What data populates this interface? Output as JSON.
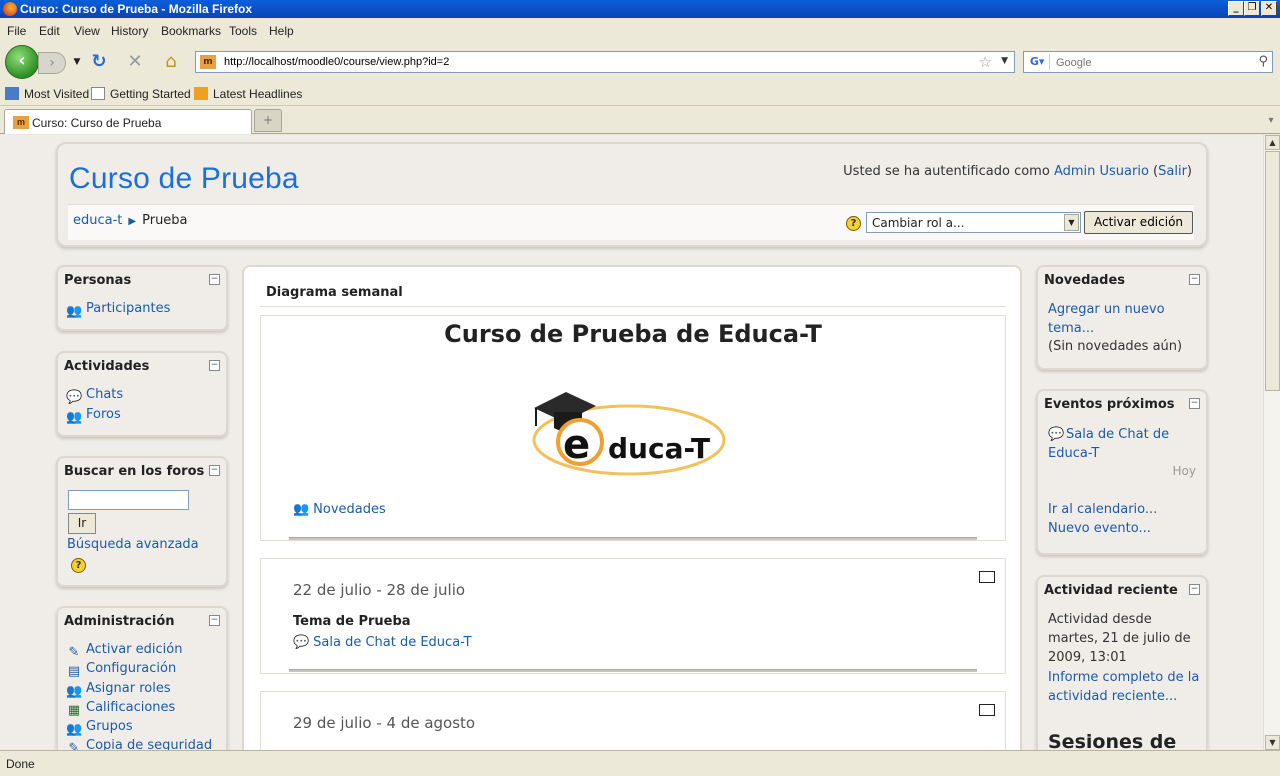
{
  "window": {
    "title": "Curso: Curso de Prueba - Mozilla Firefox"
  },
  "menu": [
    "File",
    "Edit",
    "View",
    "History",
    "Bookmarks",
    "Tools",
    "Help"
  ],
  "nav": {
    "url": "http://localhost/moodle0/course/view.php?id=2",
    "search_placeholder": "Google"
  },
  "bookmarks": [
    "Most Visited",
    "Getting Started",
    "Latest Headlines"
  ],
  "tab": {
    "label": "Curso: Curso de Prueba"
  },
  "status": "Done",
  "header": {
    "course_title": "Curso de Prueba",
    "login_prefix": "Usted se ha autentificado como",
    "user_name": "Admin Usuario",
    "logout": "Salir",
    "breadcrumb": [
      "educa-t",
      "Prueba"
    ],
    "role_select": "Cambiar rol a...",
    "edit_button": "Activar edición"
  },
  "left": {
    "personas": {
      "title": "Personas",
      "items": [
        "Participantes"
      ]
    },
    "actividades": {
      "title": "Actividades",
      "items": [
        "Chats",
        "Foros"
      ]
    },
    "buscar": {
      "title": "Buscar en los foros",
      "go": "Ir",
      "advanced": "Búsqueda avanzada"
    },
    "admin": {
      "title": "Administración",
      "items": [
        "Activar edición",
        "Configuración",
        "Asignar roles",
        "Calificaciones",
        "Grupos",
        "Copia de seguridad"
      ]
    }
  },
  "center": {
    "header": "Diagrama semanal",
    "section0": {
      "title": "Curso de Prueba de Educa-T",
      "logo_text": "educa-T",
      "forum": "Novedades"
    },
    "week1": {
      "dates": "22 de julio - 28 de julio",
      "topic": "Tema de Prueba",
      "chat": "Sala de Chat de Educa-T"
    },
    "week2": {
      "dates": "29 de julio - 4 de agosto"
    }
  },
  "right": {
    "novedades": {
      "title": "Novedades",
      "add": "Agregar un nuevo tema...",
      "empty": "(Sin novedades aún)"
    },
    "eventos": {
      "title": "Eventos próximos",
      "event": "Sala de Chat de Educa-T",
      "when": "Hoy",
      "calendar": "Ir al calendario...",
      "new_event": "Nuevo evento..."
    },
    "actividad": {
      "title": "Actividad reciente",
      "since": "Actividad desde martes, 21 de julio de 2009, 13:01",
      "report": "Informe completo de la actividad reciente...",
      "sessions": "Sesiones de"
    }
  }
}
